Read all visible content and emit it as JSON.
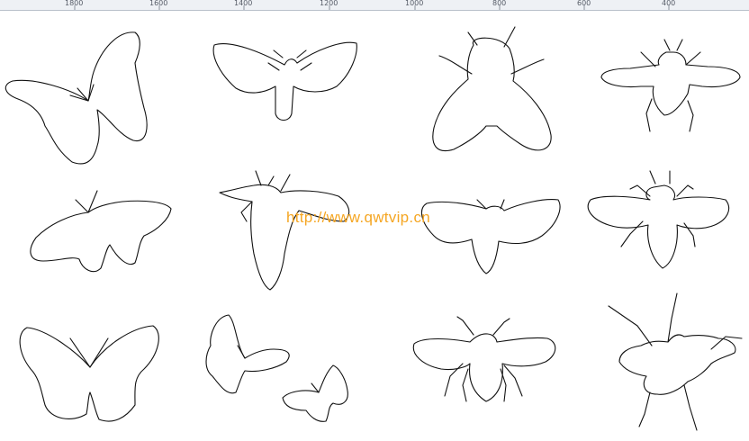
{
  "ruler": {
    "labels": [
      "1800",
      "1600",
      "1400",
      "1200",
      "1000",
      "800",
      "600",
      "400"
    ]
  },
  "canvas": {
    "watermark": "http://www.qwtvip.cn",
    "watermark_color": "#f5a623",
    "shapes": [
      {
        "name": "butterfly-1"
      },
      {
        "name": "moth-1"
      },
      {
        "name": "fly-1"
      },
      {
        "name": "bee-1"
      },
      {
        "name": "butterfly-2"
      },
      {
        "name": "moth-2"
      },
      {
        "name": "moth-3"
      },
      {
        "name": "bee-2"
      },
      {
        "name": "butterfly-3"
      },
      {
        "name": "butterflies-pair"
      },
      {
        "name": "bee-3"
      },
      {
        "name": "beetle-1"
      }
    ]
  }
}
